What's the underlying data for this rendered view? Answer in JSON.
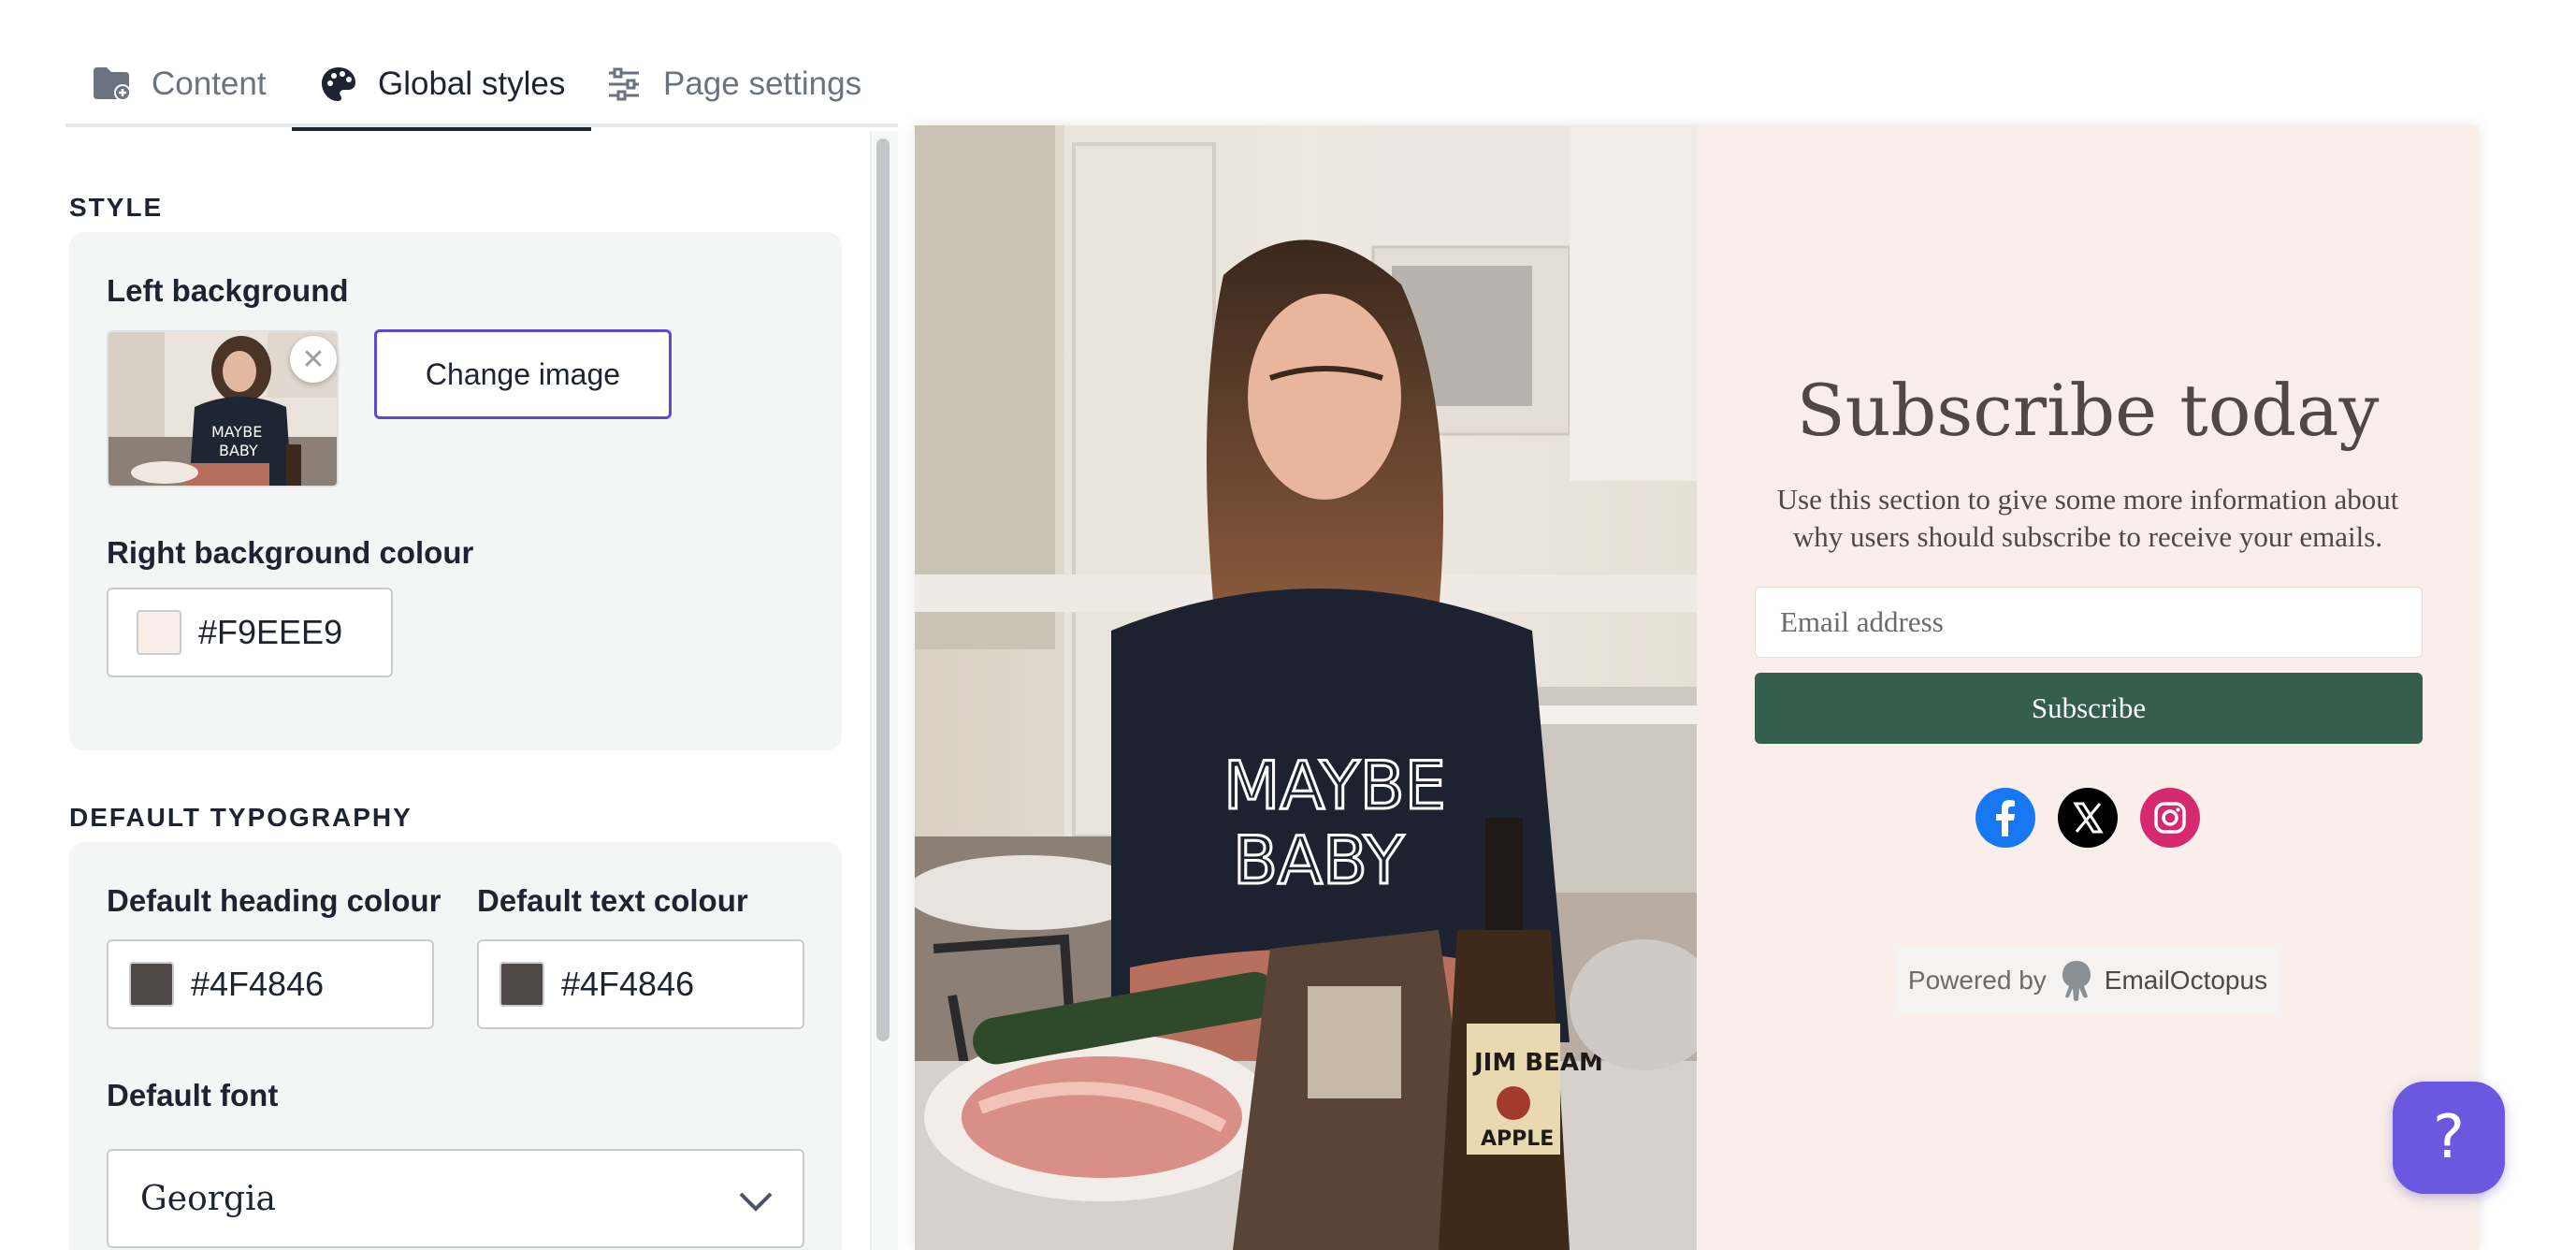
{
  "tabs": [
    {
      "label": "Content",
      "icon": "folder-plus-icon"
    },
    {
      "label": "Global styles",
      "icon": "palette-icon"
    },
    {
      "label": "Page settings",
      "icon": "sliders-icon"
    }
  ],
  "active_tab": "Global styles",
  "style": {
    "title": "STYLE",
    "left_background_label": "Left background",
    "change_image_label": "Change image",
    "remove_image_icon": "close-icon",
    "right_bg_label": "Right background colour",
    "right_bg_value": "#F9EEE9"
  },
  "typography": {
    "title": "DEFAULT TYPOGRAPHY",
    "heading_colour_label": "Default heading colour",
    "heading_colour_value": "#4F4846",
    "text_colour_label": "Default text colour",
    "text_colour_value": "#4F4846",
    "font_label": "Default font",
    "font_value": "Georgia"
  },
  "preview": {
    "heading": "Subscribe today",
    "subtext": "Use this section to give some more information about why users should subscribe to receive your emails.",
    "email_placeholder": "Email address",
    "subscribe_label": "Subscribe",
    "socials": [
      "facebook-icon",
      "x-icon",
      "instagram-icon"
    ],
    "powered_by": "Powered by",
    "brand": "EmailOctopus"
  },
  "colors": {
    "right_background": "#F9EEE9",
    "heading": "#4F4846",
    "text": "#4F4846",
    "button": "#355E4F",
    "accent": "#5A4BD1",
    "help_button": "#6B57E0"
  },
  "help_icon": "?"
}
